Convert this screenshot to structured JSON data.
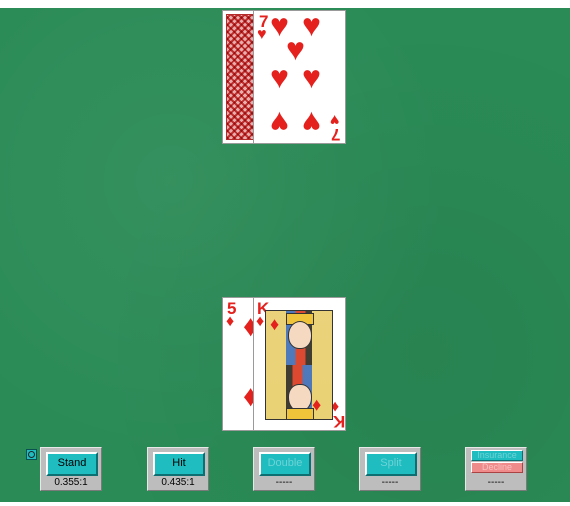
{
  "table": {
    "felt_color": "#2a8b56"
  },
  "dealer": {
    "hole_card": {
      "face_down": true,
      "back_color": "#c83a3a"
    },
    "up_card": {
      "rank": "7",
      "suit": "hearts",
      "suit_glyph": "♥"
    }
  },
  "player": {
    "cards": [
      {
        "rank": "5",
        "suit": "diamonds",
        "suit_glyph": "♦"
      },
      {
        "rank": "K",
        "suit": "diamonds",
        "suit_glyph": "♦"
      }
    ]
  },
  "controls": {
    "stand": {
      "label": "Stand",
      "odds": "0.355:1",
      "enabled": true
    },
    "hit": {
      "label": "Hit",
      "odds": "0.435:1",
      "enabled": true
    },
    "double": {
      "label": "Double",
      "odds": "-----",
      "enabled": false
    },
    "split": {
      "label": "Split",
      "odds": "-----",
      "enabled": false
    },
    "insurance": {
      "accept_label": "Insurance",
      "decline_label": "Decline",
      "odds": "-----",
      "enabled": false
    }
  },
  "accent_color": "#1fbcc0"
}
